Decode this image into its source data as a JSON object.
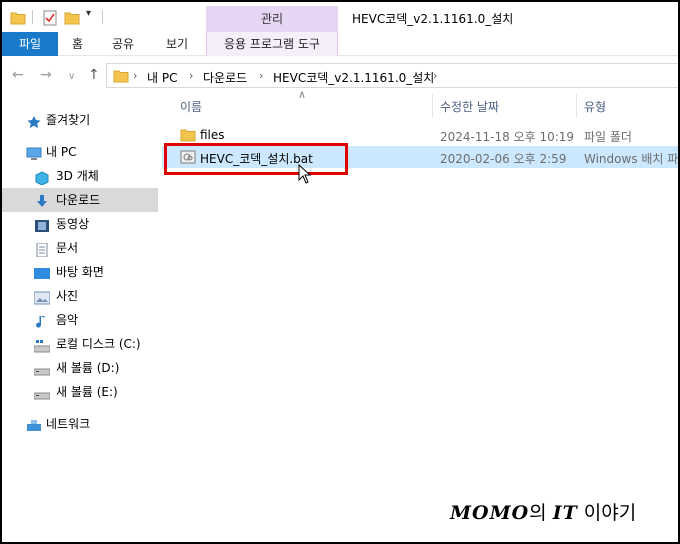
{
  "window": {
    "title": "HEVC코덱_v2.1.1161.0_설치",
    "manage_tab": "관리"
  },
  "ribbon": {
    "file": "파일",
    "home": "홈",
    "share": "공유",
    "view": "보기",
    "app_tools": "응용 프로그램 도구"
  },
  "address": {
    "crumbs": [
      "내 PC",
      "다운로드",
      "HEVC코덱_v2.1.1161.0_설치"
    ]
  },
  "sidebar": {
    "items": [
      {
        "label": "즐겨찾기",
        "icon": "star-icon"
      },
      {
        "label": "내 PC",
        "icon": "computer-icon"
      },
      {
        "label": "3D 개체",
        "icon": "cube-icon"
      },
      {
        "label": "다운로드",
        "icon": "download-icon",
        "selected": true
      },
      {
        "label": "동영상",
        "icon": "video-icon"
      },
      {
        "label": "문서",
        "icon": "document-icon"
      },
      {
        "label": "바탕 화면",
        "icon": "desktop-icon"
      },
      {
        "label": "사진",
        "icon": "picture-icon"
      },
      {
        "label": "음악",
        "icon": "music-icon"
      },
      {
        "label": "로컬 디스크 (C:)",
        "icon": "system-drive-icon"
      },
      {
        "label": "새 볼륨 (D:)",
        "icon": "drive-icon"
      },
      {
        "label": "새 볼륨 (E:)",
        "icon": "drive-icon"
      },
      {
        "label": "네트워크",
        "icon": "network-icon"
      }
    ]
  },
  "columns": {
    "name": "이름",
    "modified": "수정한 날짜",
    "type": "유형"
  },
  "files": [
    {
      "name": "files",
      "modified": "2024-11-18 오후 10:19",
      "type": "파일 폴더",
      "icon": "folder-icon"
    },
    {
      "name": "HEVC_코덱_설치.bat",
      "modified": "2020-02-06 오후 2:59",
      "type": "Windows 배치 파일",
      "icon": "batch-file-icon",
      "selected": true
    }
  ],
  "watermark": {
    "brand": "MOMO",
    "middle": "의 ",
    "it": "IT",
    "suffix": " 이야기"
  },
  "colors": {
    "file_tab": "#1979ca",
    "manage_tab": "#e7d6f3",
    "selected_row": "#cce8ff",
    "highlight": "#e00000",
    "nav_selected": "#d9d9d9"
  }
}
